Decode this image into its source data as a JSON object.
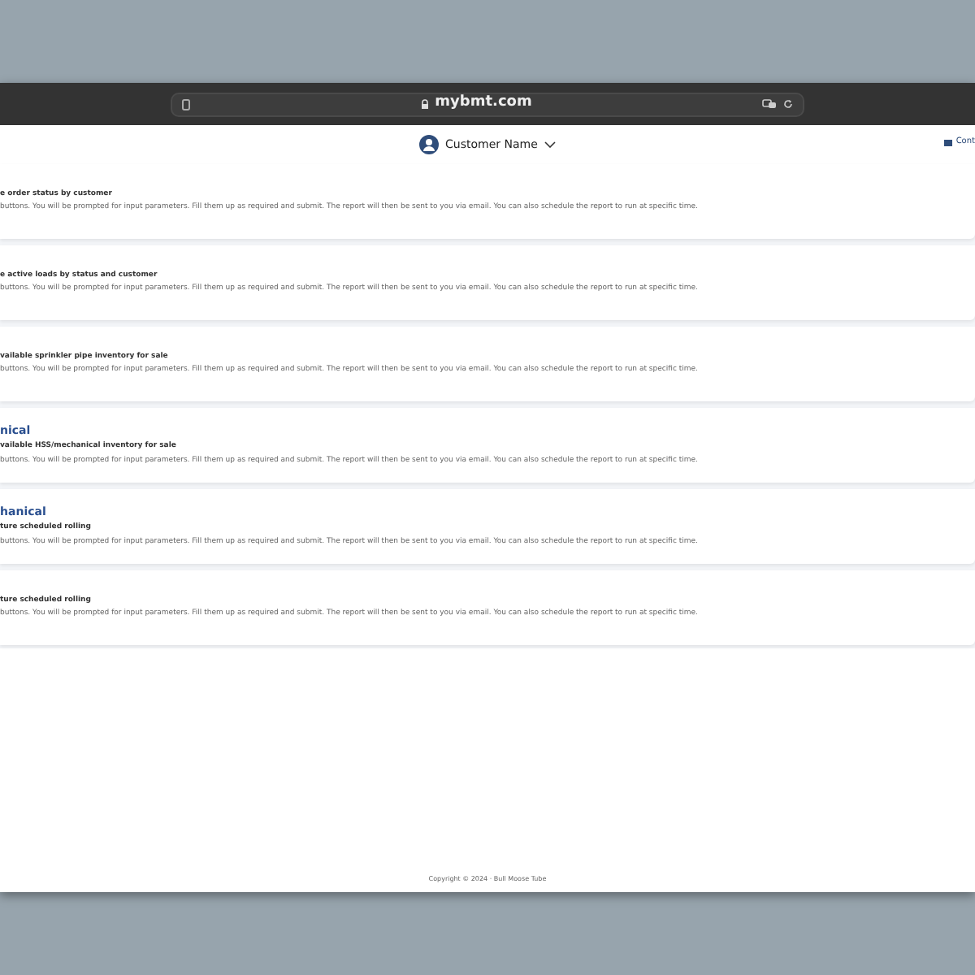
{
  "browser": {
    "address": "mybmt.com"
  },
  "header": {
    "user": "Customer Name",
    "contact": "Cont"
  },
  "reports": [
    {
      "subtitle": "e order status by customer",
      "description": "buttons. You will be prompted for input parameters. Fill them up as required and submit. The report will then be sent to you via email. You can also schedule the report to run at specific time."
    },
    {
      "subtitle": "e active loads by status and customer",
      "description": "buttons. You will be prompted for input parameters. Fill them up as required and submit. The report will then be sent to you via email. You can also schedule the report to run at specific time."
    },
    {
      "subtitle": "vailable sprinkler pipe inventory for sale",
      "description": "buttons. You will be prompted for input parameters. Fill them up as required and submit. The report will then be sent to you via email. You can also schedule the report to run at specific time."
    },
    {
      "title": "nical",
      "subtitle": "vailable HSS/mechanical inventory for sale",
      "description": "buttons. You will be prompted for input parameters. Fill them up as required and submit. The report will then be sent to you via email. You can also schedule the report to run at specific time."
    },
    {
      "title": "hanical",
      "subtitle": "ture scheduled rolling",
      "description": "buttons. You will be prompted for input parameters. Fill them up as required and submit. The report will then be sent to you via email. You can also schedule the report to run at specific time."
    },
    {
      "subtitle": "ture scheduled rolling",
      "description": "buttons. You will be prompted for input parameters. Fill them up as required and submit. The report will then be sent to you via email. You can also schedule the report to run at specific time."
    }
  ],
  "footer": "Copyright © 2024 · Bull Moose Tube"
}
